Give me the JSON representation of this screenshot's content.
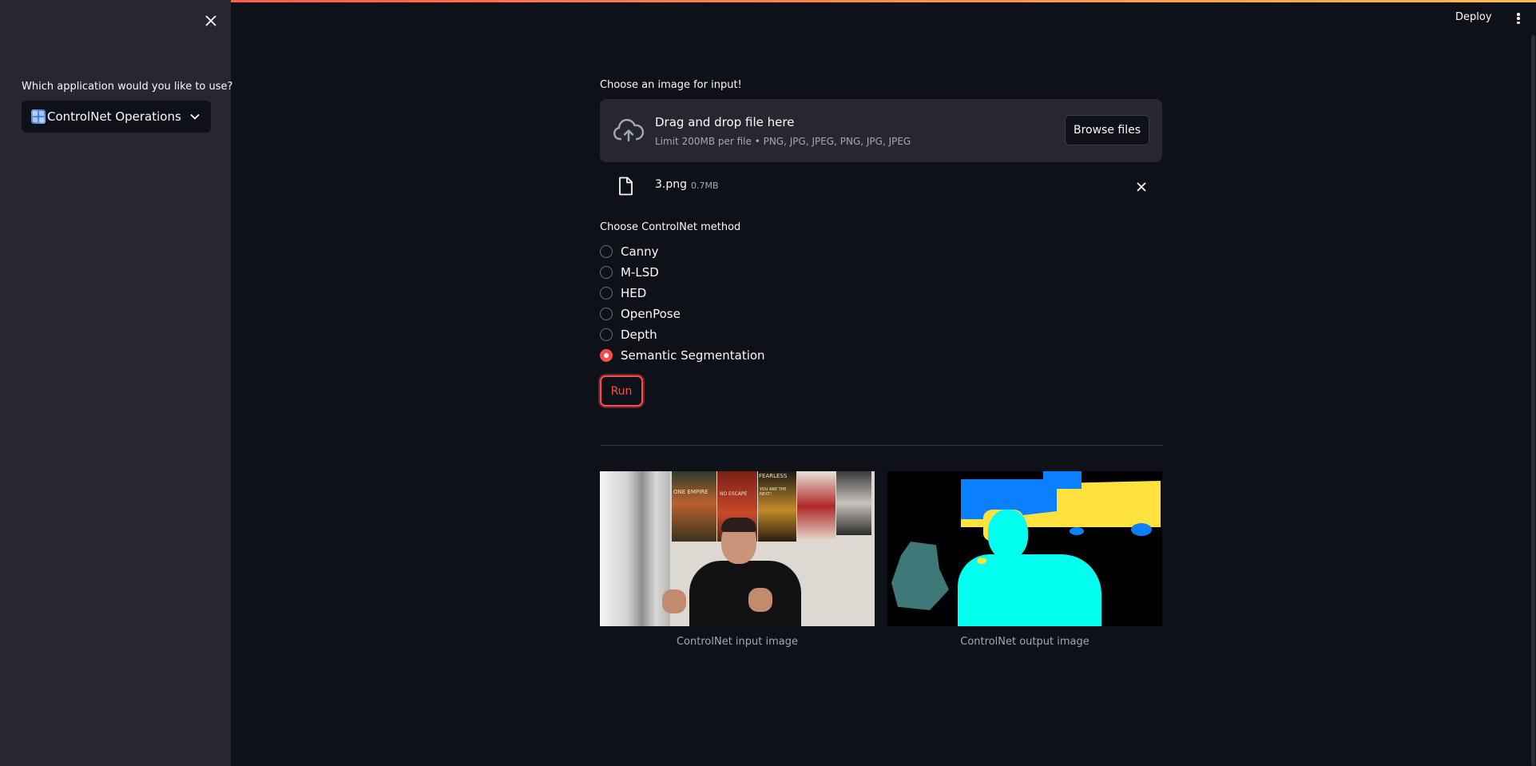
{
  "sidebar": {
    "select_label": "Which application would you like to use?",
    "select_value": "ControlNet Operations"
  },
  "header": {
    "deploy_label": "Deploy"
  },
  "uploader": {
    "label": "Choose an image for input!",
    "drop_title": "Drag and drop file here",
    "drop_limit": "Limit 200MB per file • PNG, JPG, JPEG, PNG, JPG, JPEG",
    "browse_label": "Browse files",
    "file": {
      "name": "3.png",
      "size": "0.7MB"
    }
  },
  "method": {
    "label": "Choose ControlNet method",
    "options": [
      "Canny",
      "M-LSD",
      "HED",
      "OpenPose",
      "Depth",
      "Semantic Segmentation"
    ],
    "selected": "Semantic Segmentation"
  },
  "run_label": "Run",
  "images": {
    "input_caption": "ControlNet input image",
    "output_caption": "ControlNet output image",
    "poster_texts": [
      "ONE EMPIRE",
      "NO ESCAPE",
      "YOU ARE THE NEXT!",
      "FEARLESS"
    ]
  },
  "colors": {
    "accent": "#ff4b4b",
    "background": "#0e1117",
    "sidebar": "#262730",
    "seg_cyan": "#00ffee",
    "seg_blue": "#0a80ff",
    "seg_yellow": "#ffe23d",
    "seg_teal": "#3f7878"
  }
}
